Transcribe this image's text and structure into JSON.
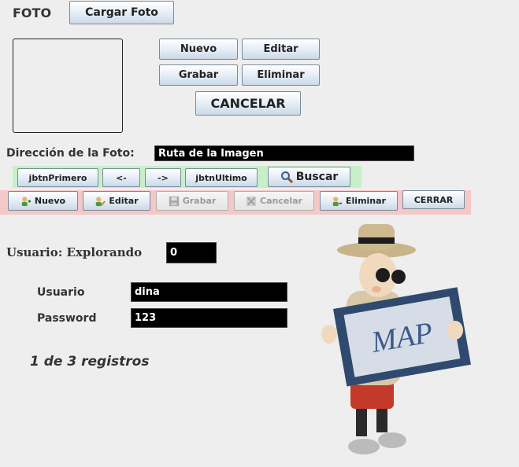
{
  "photo_section": {
    "title": "FOTO",
    "load_button": "Cargar Foto"
  },
  "actions": {
    "nuevo": "Nuevo",
    "editar": "Editar",
    "grabar": "Grabar",
    "eliminar": "Eliminar",
    "cancelar": "CANCELAR"
  },
  "photo_path": {
    "label": "Dirección de la Foto:",
    "value": "Ruta de la Imagen"
  },
  "nav_bar": {
    "first": "jbtnPrimero",
    "prev": "<-",
    "next": "->",
    "last": "jbtnUltimo",
    "search": "Buscar",
    "search_icon": "magnifier-icon",
    "color": "#c8f0c8"
  },
  "crud_bar": {
    "nuevo": "Nuevo",
    "editar": "Editar",
    "grabar": "Grabar",
    "cancelar": "Cancelar",
    "eliminar": "Eliminar",
    "cerrar": "CERRAR",
    "color": "#f5c8c8",
    "icons": [
      "user-add-icon",
      "user-edit-icon",
      "save-icon",
      "cancel-icon",
      "user-delete-icon"
    ]
  },
  "status": {
    "mode_label": "Usuario: Explorando",
    "mode_value": "0"
  },
  "form": {
    "usuario_label": "Usuario",
    "usuario_value": "dina",
    "password_label": "Password",
    "password_value": "123"
  },
  "records": "1 de 3 registros",
  "illustration": {
    "map_text": "MAP"
  }
}
